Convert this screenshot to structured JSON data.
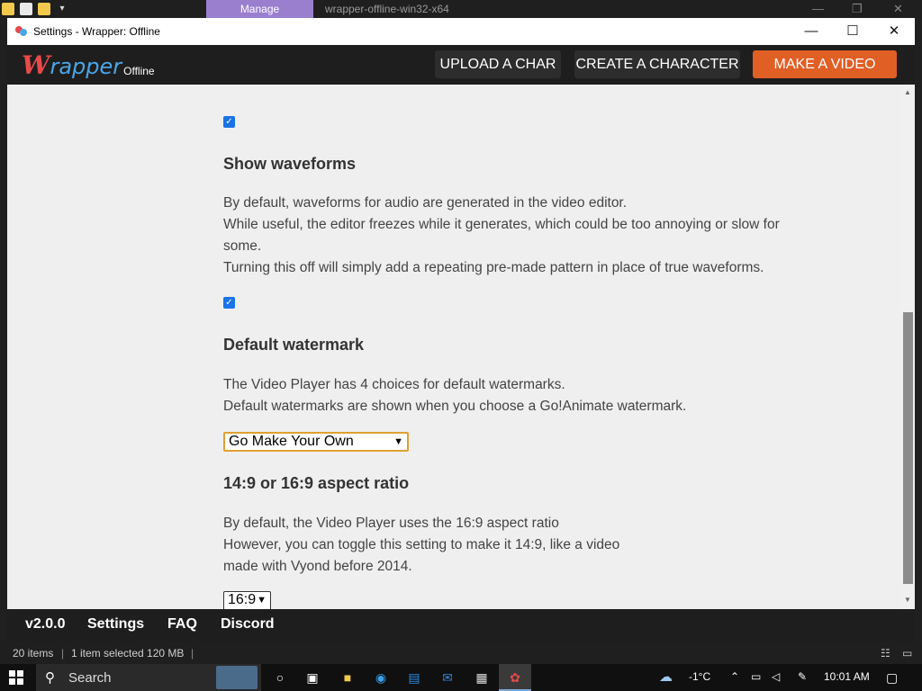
{
  "explorer": {
    "manage_tab": "Manage",
    "title": "wrapper-offline-win32-x64",
    "minimize": "—",
    "restore": "❐",
    "close": "✕"
  },
  "window": {
    "title": "Settings - Wrapper: Offline",
    "minimize": "—",
    "maximize": "☐",
    "close": "✕"
  },
  "header": {
    "logo_w": "W",
    "logo_rest": "rapper",
    "logo_suffix": "Offline",
    "buttons": [
      "UPLOAD A CHAR",
      "CREATE A CHARACTER",
      "MAKE A VIDEO"
    ]
  },
  "settings": {
    "waveforms": {
      "title": "Show waveforms",
      "lines": [
        "By default, waveforms for audio are generated in the video editor.",
        "While useful, the editor freezes while it generates, which could be too annoying or slow for",
        "some.",
        "Turning this off will simply add a repeating pre-made pattern in place of true waveforms."
      ],
      "checked": true
    },
    "watermark": {
      "title": "Default watermark",
      "lines": [
        "The Video Player has 4 choices for default watermarks.",
        "Default watermarks are shown when you choose a Go!Animate watermark."
      ],
      "selected": "Go Make Your Own"
    },
    "aspect": {
      "title": "14:9 or 16:9 aspect ratio",
      "lines": [
        "By default, the Video Player uses the 16:9 aspect ratio",
        "However, you can toggle this setting to make it 14:9, like a video",
        "made with Vyond before 2014."
      ],
      "selected": "16:9"
    }
  },
  "footer": {
    "version": "v2.0.0",
    "links": [
      "Settings",
      "FAQ",
      "Discord"
    ]
  },
  "statusbar": {
    "items": "20 items",
    "selected": "1 item selected  120 MB"
  },
  "taskbar": {
    "search": "Search",
    "temperature": "-1°C",
    "time": "10:01 AM"
  }
}
